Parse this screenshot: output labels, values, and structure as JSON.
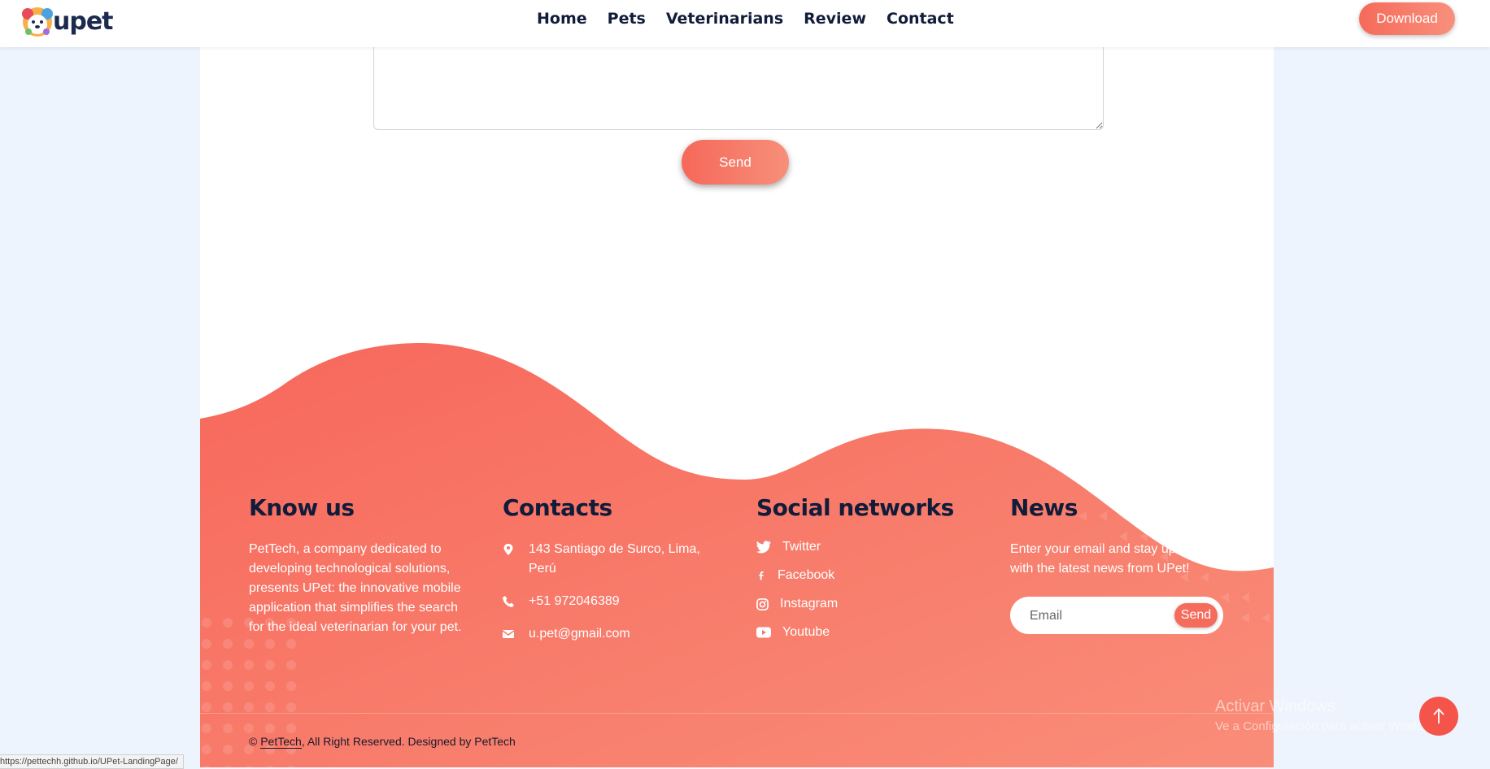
{
  "header": {
    "logo_text": "upet",
    "nav": [
      "Home",
      "Pets",
      "Veterinarians",
      "Review",
      "Contact"
    ],
    "download_label": "Download"
  },
  "form": {
    "send_label": "Send"
  },
  "footer": {
    "know_us": {
      "title": "Know us",
      "text": "PetTech, a company dedicated to developing technological solutions, presents UPet: the innovative mobile application that simplifies the search for the ideal veterinarian for your pet."
    },
    "contacts": {
      "title": "Contacts",
      "address": "143 Santiago de Surco, Lima, Perú",
      "phone": "+51 972046389",
      "email": "u.pet@gmail.com"
    },
    "social": {
      "title": "Social networks",
      "items": [
        "Twitter",
        "Facebook",
        "Instagram",
        "Youtube"
      ]
    },
    "news": {
      "title": "News",
      "text": "Enter your email and stay up to date with the latest news from UPet!",
      "email_placeholder": "Email",
      "send_label": "Send"
    },
    "copyright": {
      "prefix": "© ",
      "link": "PetTech",
      "suffix": ", All Right Reserved. Designed by PetTech"
    }
  },
  "watermark": {
    "line1": "Activar Windows",
    "line2": "Ve a Configuración para activar Windows."
  },
  "status_url": "https://pettechh.github.io/UPet-LandingPage/",
  "colors": {
    "accent": "#f66a5a",
    "footer_start": "#f7685b",
    "footer_end": "#f98d79",
    "heading": "#111c3a"
  }
}
